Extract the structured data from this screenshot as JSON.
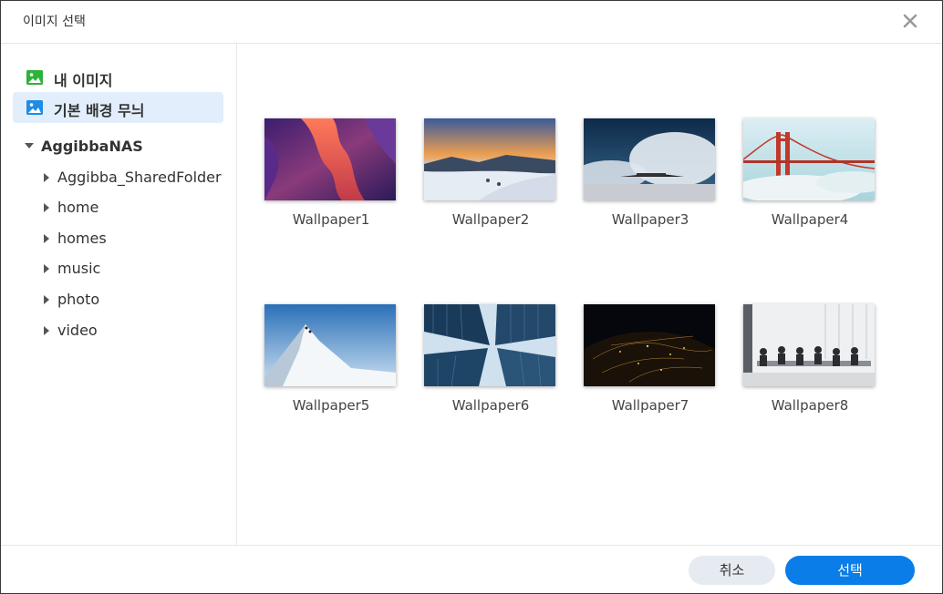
{
  "dialog": {
    "title": "이미지 선택"
  },
  "sidebar": {
    "items": [
      {
        "label": "내 이미지",
        "icon": "image-icon",
        "color": "#2db23a",
        "active": false
      },
      {
        "label": "기본 배경 무늬",
        "icon": "image-icon",
        "color": "#1f8ce6",
        "active": true
      }
    ],
    "tree": {
      "root": "AggibbaNAS",
      "children": [
        "Aggibba_SharedFolder",
        "home",
        "homes",
        "music",
        "photo",
        "video"
      ]
    }
  },
  "wallpapers": [
    {
      "name": "Wallpaper1"
    },
    {
      "name": "Wallpaper2"
    },
    {
      "name": "Wallpaper3"
    },
    {
      "name": "Wallpaper4"
    },
    {
      "name": "Wallpaper5"
    },
    {
      "name": "Wallpaper6"
    },
    {
      "name": "Wallpaper7"
    },
    {
      "name": "Wallpaper8"
    }
  ],
  "footer": {
    "cancel_label": "취소",
    "ok_label": "선택"
  },
  "colors": {
    "accent": "#0a7de8",
    "active_bg": "#e2eefb",
    "cancel_bg": "#e6ebf2"
  }
}
